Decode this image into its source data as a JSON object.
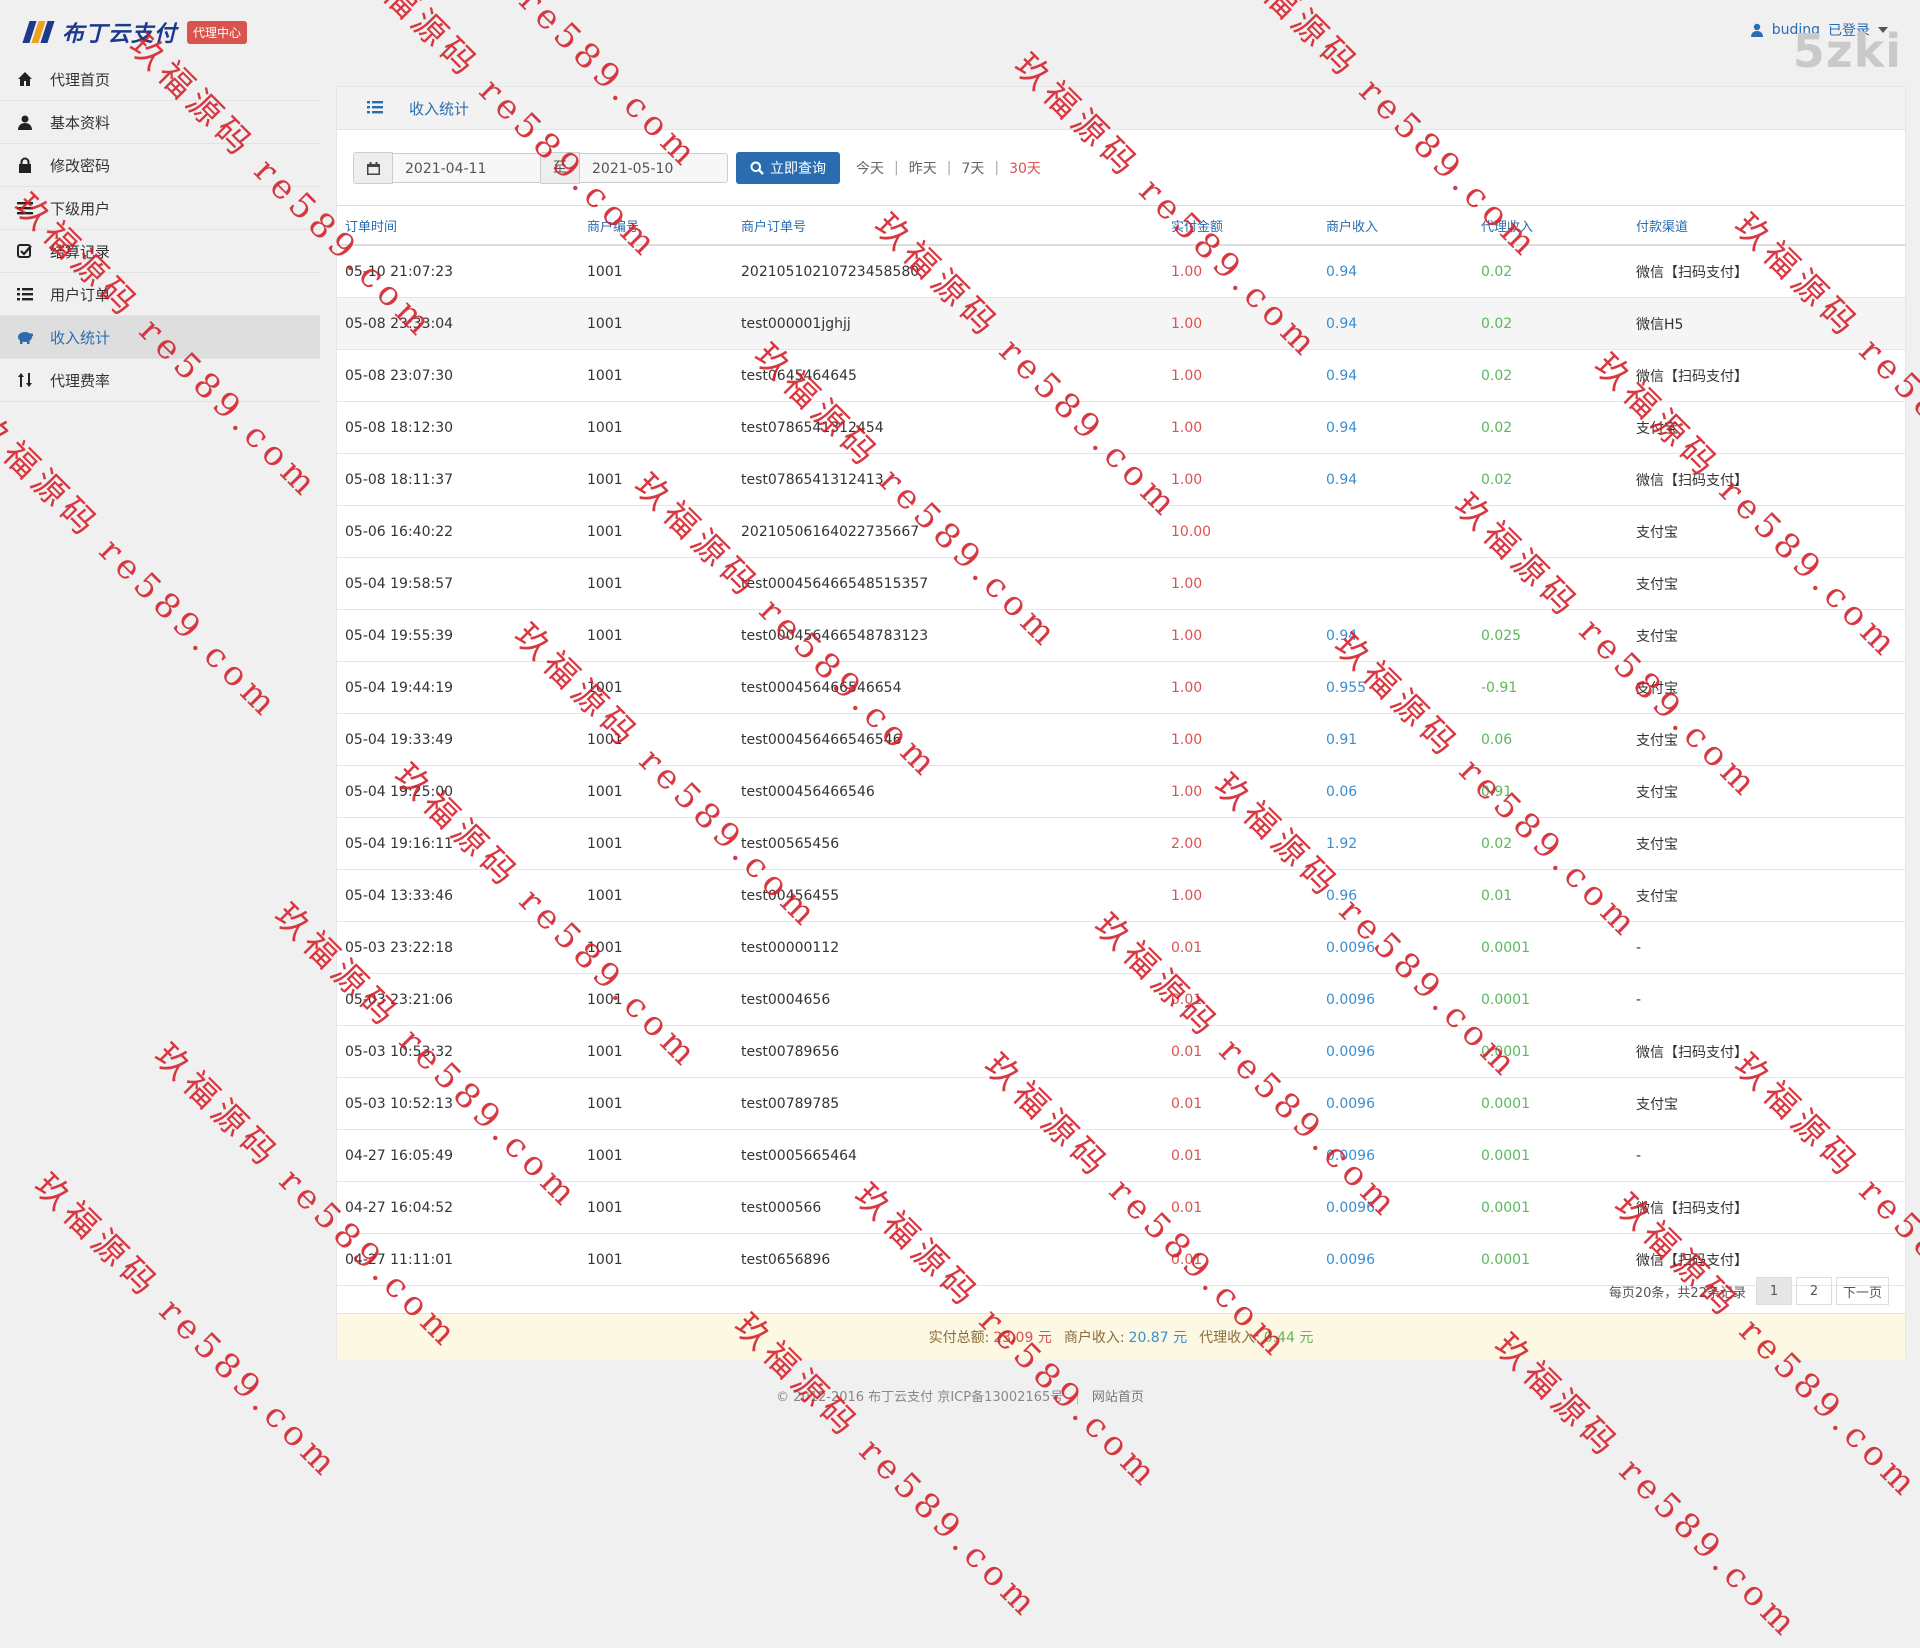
{
  "header": {
    "logo_text": "布丁云支付",
    "badge": "代理中心",
    "username": "buding",
    "login_status": "已登录",
    "corner_mark": "5zki"
  },
  "sidebar": {
    "items": [
      {
        "label": "代理首页",
        "icon": "home-icon"
      },
      {
        "label": "基本资料",
        "icon": "user-icon"
      },
      {
        "label": "修改密码",
        "icon": "lock-icon"
      },
      {
        "label": "下级用户",
        "icon": "menu-icon"
      },
      {
        "label": "结算记录",
        "icon": "check-icon"
      },
      {
        "label": "用户订单",
        "icon": "list-icon"
      },
      {
        "label": "收入统计",
        "icon": "piggy-bank-icon",
        "active": true
      },
      {
        "label": "代理费率",
        "icon": "sort-icon"
      }
    ]
  },
  "panel": {
    "title": "收入统计"
  },
  "query": {
    "start_date": "2021-04-11",
    "to_label": "至",
    "end_date": "2021-05-10",
    "button_label": "立即查询",
    "quick": [
      "今天",
      "昨天",
      "7天",
      "30天"
    ],
    "quick_selected": "30天"
  },
  "table": {
    "columns": [
      "订单时间",
      "商户编号",
      "商户订单号",
      "实付金额",
      "商户收入",
      "代理收入",
      "付款渠道"
    ],
    "rows": [
      [
        "05-10 21:07:23",
        "1001",
        "20210510210723458580",
        "1.00",
        "0.94",
        "0.02",
        "微信【扫码支付】"
      ],
      [
        "05-08 23:33:04",
        "1001",
        "test000001jghjj",
        "1.00",
        "0.94",
        "0.02",
        "微信H5"
      ],
      [
        "05-08 23:07:30",
        "1001",
        "test0645464645",
        "1.00",
        "0.94",
        "0.02",
        "微信【扫码支付】"
      ],
      [
        "05-08 18:12:30",
        "1001",
        "test0786541312454",
        "1.00",
        "0.94",
        "0.02",
        "支付宝"
      ],
      [
        "05-08 18:11:37",
        "1001",
        "test0786541312413",
        "1.00",
        "0.94",
        "0.02",
        "微信【扫码支付】"
      ],
      [
        "05-06 16:40:22",
        "1001",
        "20210506164022735667",
        "10.00",
        "",
        "",
        "支付宝"
      ],
      [
        "05-04 19:58:57",
        "1001",
        "test000456466548515357",
        "1.00",
        "",
        "",
        "支付宝"
      ],
      [
        "05-04 19:55:39",
        "1001",
        "test000456466548783123",
        "1.00",
        "0.94",
        "0.025",
        "支付宝"
      ],
      [
        "05-04 19:44:19",
        "1001",
        "test000456466546654",
        "1.00",
        "0.955",
        "-0.91",
        "支付宝"
      ],
      [
        "05-04 19:33:49",
        "1001",
        "test000456466546546",
        "1.00",
        "0.91",
        "0.06",
        "支付宝"
      ],
      [
        "05-04 19:25:00",
        "1001",
        "test000456466546",
        "1.00",
        "0.06",
        "0.91",
        "支付宝"
      ],
      [
        "05-04 19:16:11",
        "1001",
        "test00565456",
        "2.00",
        "1.92",
        "0.02",
        "支付宝"
      ],
      [
        "05-04 13:33:46",
        "1001",
        "test00456455",
        "1.00",
        "0.96",
        "0.01",
        "支付宝"
      ],
      [
        "05-03 23:22:18",
        "1001",
        "test00000112",
        "0.01",
        "0.0096",
        "0.0001",
        "-"
      ],
      [
        "05-03 23:21:06",
        "1001",
        "test0004656",
        "0.01",
        "0.0096",
        "0.0001",
        "-"
      ],
      [
        "05-03 10:53:32",
        "1001",
        "test00789656",
        "0.01",
        "0.0096",
        "0.0001",
        "微信【扫码支付】"
      ],
      [
        "05-03 10:52:13",
        "1001",
        "test00789785",
        "0.01",
        "0.0096",
        "0.0001",
        "支付宝"
      ],
      [
        "04-27 16:05:49",
        "1001",
        "test0005665464",
        "0.01",
        "0.0096",
        "0.0001",
        "-"
      ],
      [
        "04-27 16:04:52",
        "1001",
        "test000566",
        "0.01",
        "0.0096",
        "0.0001",
        "微信【扫码支付】"
      ],
      [
        "04-27 11:11:01",
        "1001",
        "test0656896",
        "0.01",
        "0.0096",
        "0.0001",
        "微信【扫码支付】"
      ]
    ]
  },
  "pager": {
    "info": "每页20条，共22条记录",
    "pages": [
      "1",
      "2"
    ],
    "current": "1",
    "next": "下一页"
  },
  "summary": {
    "paid_label": "实付总额:",
    "paid_value": "23.09 元",
    "merchant_label": "商户收入:",
    "merchant_value": "20.87 元",
    "agent_label": "代理收入:",
    "agent_value": "0.44 元"
  },
  "footer": {
    "copyright": "© 2012-2016 布丁云支付 京ICP备13002165号",
    "sep": "|",
    "home_link": "网站首页"
  },
  "watermark": {
    "text": "玖福源码 re589.com"
  },
  "colors": {
    "primary": "#2a6cb0",
    "amount_red": "#d9534f",
    "income_blue": "#3a8ed0",
    "income_green": "#5cb85c",
    "watermark_red": "#d21e28"
  }
}
